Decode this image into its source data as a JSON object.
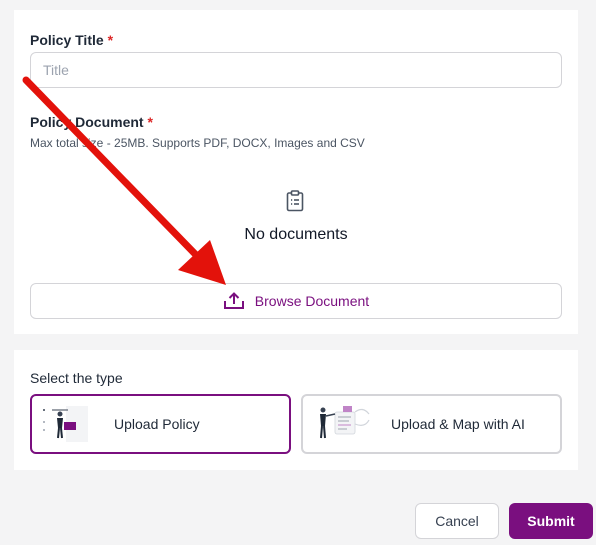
{
  "policy_title": {
    "label": "Policy Title",
    "required_mark": "*",
    "placeholder": "Title",
    "value": ""
  },
  "policy_document": {
    "label": "Policy Document",
    "required_mark": "*",
    "hint": "Max total size - 25MB. Supports PDF, DOCX, Images and CSV",
    "empty_state": "No documents",
    "browse_label": "Browse Document",
    "icons": {
      "empty": "clipboard-icon",
      "browse": "upload-icon"
    }
  },
  "type_select": {
    "label": "Select the type",
    "options": [
      {
        "label": "Upload Policy",
        "selected": true,
        "icon": "upload-policy-illustration"
      },
      {
        "label": "Upload & Map with AI",
        "selected": false,
        "icon": "ai-map-illustration"
      }
    ]
  },
  "footer": {
    "cancel_label": "Cancel",
    "submit_label": "Submit"
  },
  "colors": {
    "accent": "#7a0f7f",
    "required": "#dc2626",
    "annotation_arrow": "#e3120b",
    "border": "#d4d4d8",
    "page_background": "#f4f4f5"
  }
}
